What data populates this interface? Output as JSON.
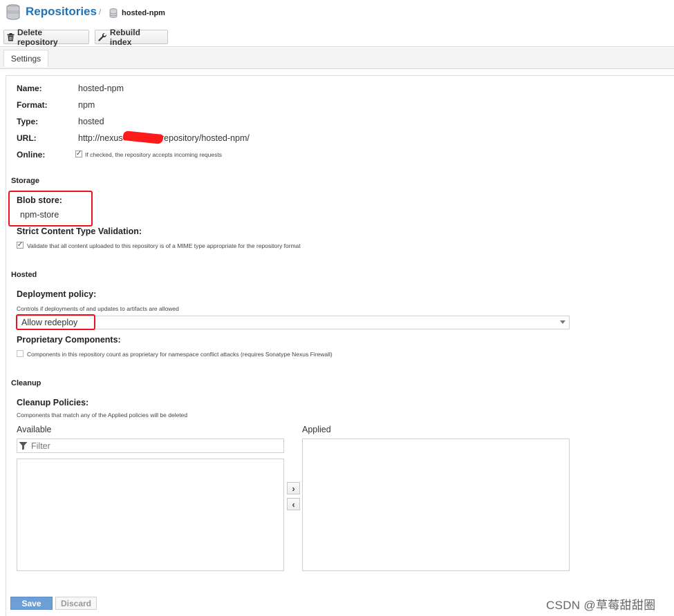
{
  "header": {
    "root_label": "Repositories",
    "separator": "/",
    "current": "hosted-npm"
  },
  "toolbar": {
    "delete_label": "Delete repository",
    "rebuild_label": "Rebuild index"
  },
  "tabs": [
    {
      "label": "Settings"
    }
  ],
  "summary": {
    "name_label": "Name:",
    "name_value": "hosted-npm",
    "format_label": "Format:",
    "format_value": "npm",
    "type_label": "Type:",
    "type_value": "hosted",
    "url_label": "URL:",
    "url_prefix": "http://nexus",
    "url_suffix": "repository/hosted-npm/",
    "online_label": "Online:",
    "online_checked": true,
    "online_help": "If checked, the repository accepts incoming requests"
  },
  "storage": {
    "section_title": "Storage",
    "blob_store_label": "Blob store:",
    "blob_store_value": "npm-store",
    "strict_label": "Strict Content Type Validation:",
    "strict_checked": true,
    "strict_help": "Validate that all content uploaded to this repository is of a MIME type appropriate for the repository format"
  },
  "hosted": {
    "section_title": "Hosted",
    "deployment_label": "Deployment policy:",
    "deployment_help": "Controls if deployments of and updates to artifacts are allowed",
    "deployment_value": "Allow redeploy",
    "proprietary_label": "Proprietary Components:",
    "proprietary_checked": false,
    "proprietary_help": "Components in this repository count as proprietary for namespace conflict attacks (requires Sonatype Nexus Firewall)"
  },
  "cleanup": {
    "section_title": "Cleanup",
    "policies_label": "Cleanup Policies:",
    "policies_help": "Components that match any of the Applied policies will be deleted",
    "available_label": "Available",
    "applied_label": "Applied",
    "filter_placeholder": "Filter",
    "move_right": "›",
    "move_left": "‹"
  },
  "footer": {
    "save_label": "Save",
    "discard_label": "Discard"
  },
  "watermark": "CSDN @草莓甜甜圈",
  "colors": {
    "link_blue": "#1e73b8",
    "save_blue": "#6d9fd6",
    "highlight_red": "#e8141b"
  },
  "icons": {
    "header": "database-stack-icon",
    "breadcrumb": "database-icon",
    "delete": "trash-icon",
    "rebuild": "wrench-icon",
    "filter": "filter-icon"
  }
}
